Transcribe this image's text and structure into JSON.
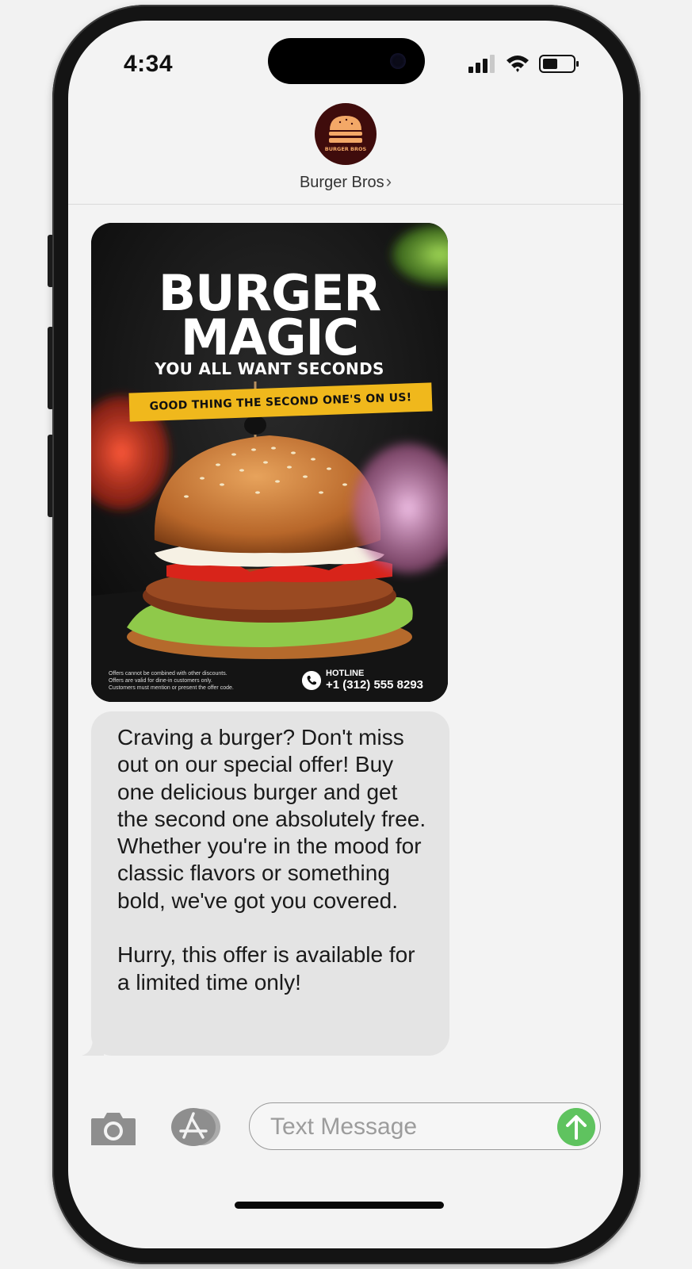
{
  "status_bar": {
    "time": "4:34",
    "signal_icon": "cellular-signal-icon",
    "wifi_icon": "wifi-icon",
    "battery_icon": "battery-icon"
  },
  "contact": {
    "name": "Burger Bros",
    "avatar_text": "BURGER BROS",
    "chevron": "›"
  },
  "poster": {
    "title_line1": "BURGER",
    "title_line2": "MAGIC",
    "subtitle": "YOU ALL WANT SECONDS",
    "banner": "GOOD THING THE SECOND ONE'S ON US!",
    "disclaimer": [
      "Offers cannot be combined with other discounts.",
      "Offers are valid for dine-in customers only.",
      "Customers must mention or present the offer code."
    ],
    "hotline_label": "HOTLINE",
    "hotline_number": "+1 (312) 555 8293"
  },
  "message": {
    "text": "Craving a burger? Don't miss out on our special offer! Buy one delicious burger and get the second one absolutely free. Whether you're in the mood for classic flavors or something bold, we've got you covered.\n\nHurry, this offer is available for a limited time only!"
  },
  "input": {
    "placeholder": "Text Message",
    "value": ""
  },
  "colors": {
    "avatar_bg": "#3f0c0c",
    "send_button": "#5fc35f",
    "banner": "#f0b81c",
    "bubble": "#e4e4e4"
  }
}
